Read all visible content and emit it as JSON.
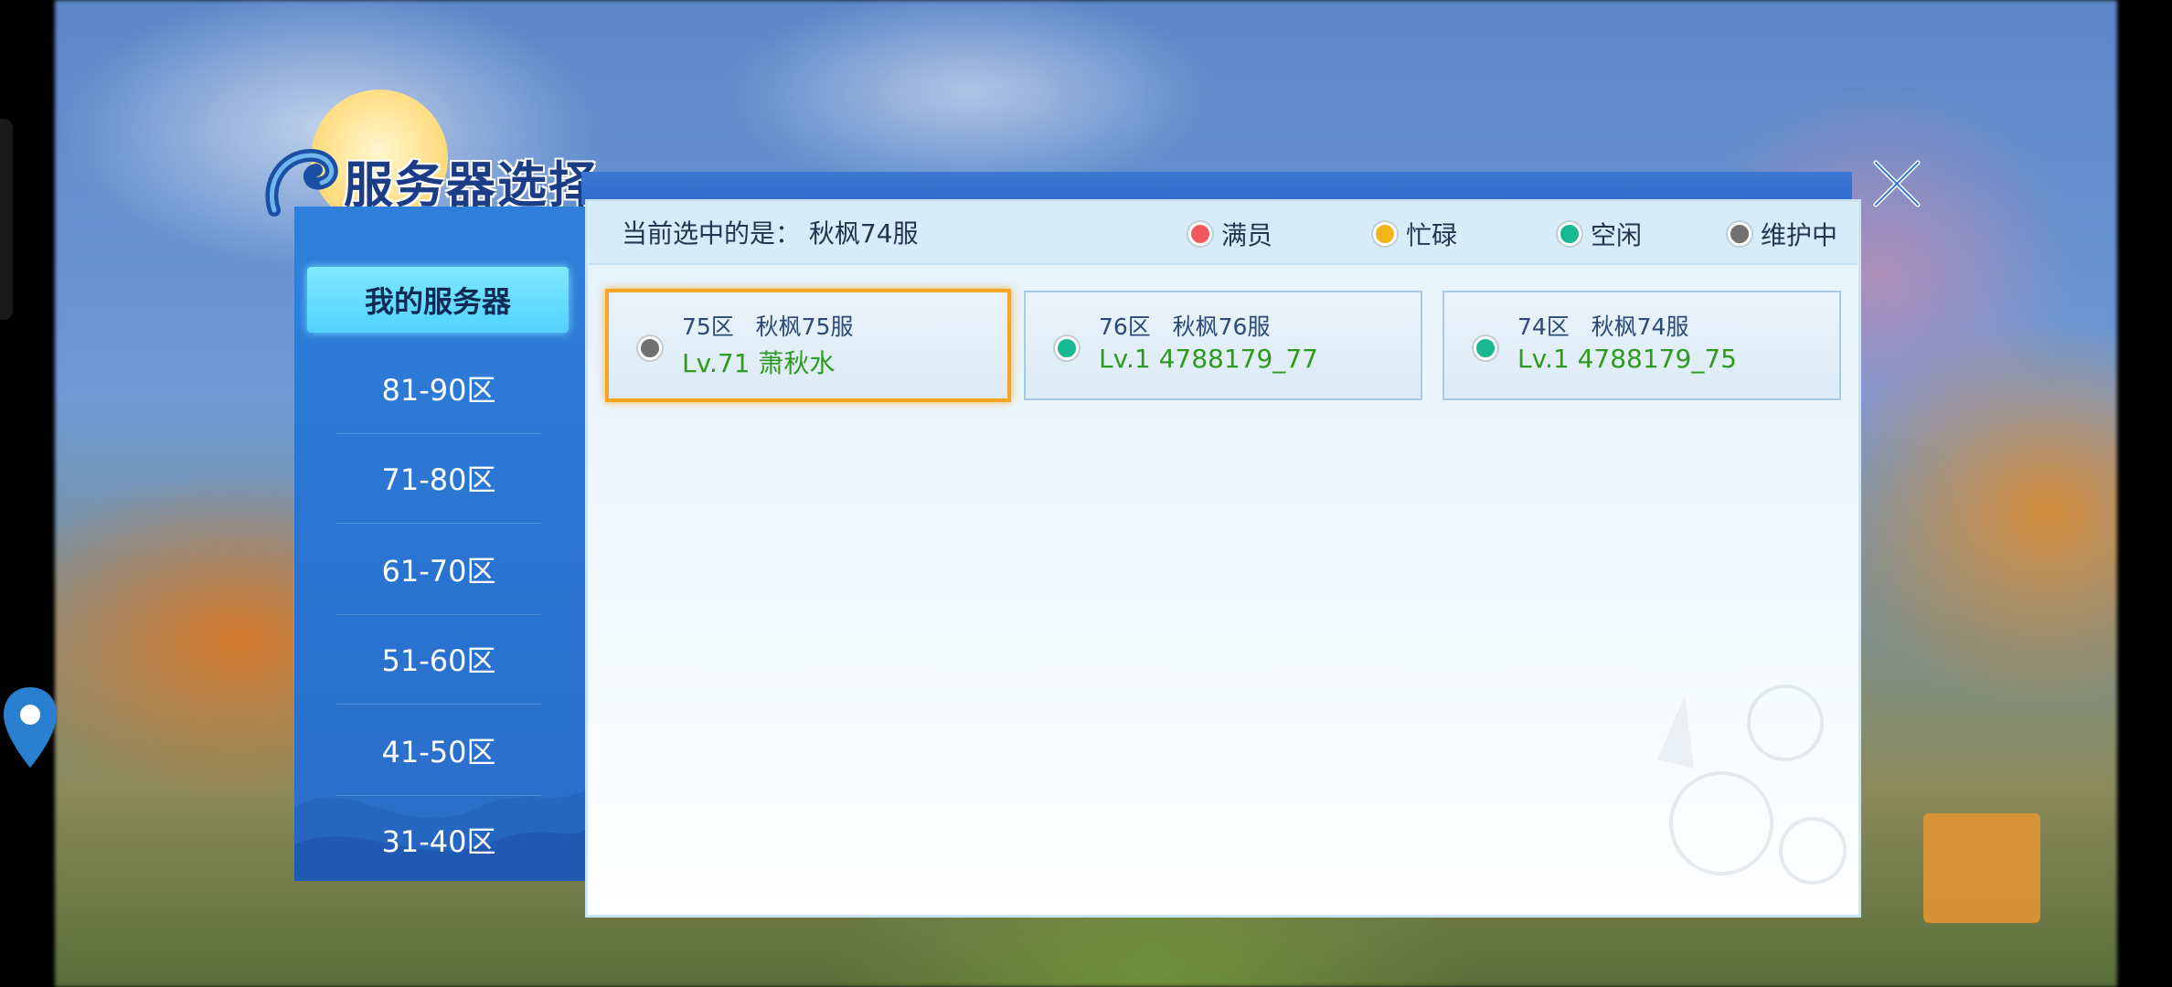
{
  "title": "服务器选择",
  "sidebar": {
    "items": [
      {
        "label": "我的服务器",
        "active": true
      },
      {
        "label": "81-90区"
      },
      {
        "label": "71-80区"
      },
      {
        "label": "61-70区"
      },
      {
        "label": "51-60区"
      },
      {
        "label": "41-50区"
      },
      {
        "label": "31-40区"
      }
    ]
  },
  "status": {
    "current_selected": "当前选中的是：  秋枫74服"
  },
  "legend": [
    {
      "label": "满员",
      "color": "#f05a5a"
    },
    {
      "label": "忙碌",
      "color": "#f2b51a"
    },
    {
      "label": "空闲",
      "color": "#18b894"
    },
    {
      "label": "维护中",
      "color": "#707070"
    }
  ],
  "servers": [
    {
      "zone": "75区",
      "name": "秋枫75服",
      "role": "Lv.71 萧秋水",
      "status_color": "#707070",
      "selected": true
    },
    {
      "zone": "76区",
      "name": "秋枫76服",
      "role": "Lv.1 4788179_77",
      "status_color": "#18b894",
      "selected": false
    },
    {
      "zone": "74区",
      "name": "秋枫74服",
      "role": "Lv.1 4788179_75",
      "status_color": "#18b894",
      "selected": false
    }
  ],
  "colors": {
    "accent": "#52d2ff",
    "selected_border": "#f5a623",
    "role_text": "#2e9a1e"
  }
}
